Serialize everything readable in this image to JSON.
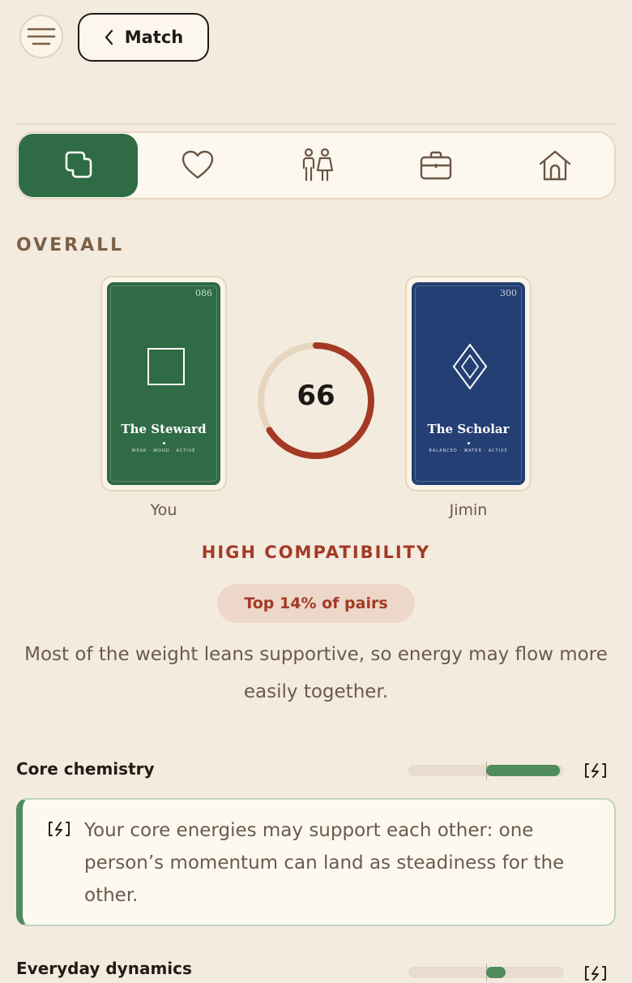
{
  "header": {
    "menu_icon": "hamburger-icon",
    "back_label": "Match",
    "back_icon": "chevron-left-icon"
  },
  "tabs": [
    {
      "icon": "overlap-squares-icon",
      "active": true
    },
    {
      "icon": "heart-icon",
      "active": false
    },
    {
      "icon": "people-icon",
      "active": false
    },
    {
      "icon": "briefcase-icon",
      "active": false
    },
    {
      "icon": "home-icon",
      "active": false
    }
  ],
  "overall": {
    "section_label": "OVERALL",
    "you_card": {
      "number": "086",
      "title": "The Steward",
      "subtitle": "WEAK · WOOD · ACTIVE",
      "color": "#2f6b45",
      "label": "You",
      "symbol": "square-icon"
    },
    "partner_card": {
      "number": "300",
      "title": "The Scholar",
      "subtitle": "BALANCED · WATER · ACTIVE",
      "color": "#233f73",
      "label": "Jimin",
      "symbol": "diamond-icon"
    },
    "score": "66",
    "score_fraction": 0.66,
    "compatibility_label": "HIGH COMPATIBILITY",
    "rank_pill": "Top 14% of pairs",
    "description": "Most of the weight leans supportive, so energy may flow more easily together."
  },
  "metrics": [
    {
      "label": "Core chemistry",
      "from": 0,
      "to": 0.95,
      "icon": "energy-icon",
      "note": "Your core energies may support each other: one person’s momentum can land as steadiness for the other."
    },
    {
      "label": "Everyday dynamics",
      "from": 0,
      "to": 0.25,
      "icon": "energy-icon"
    }
  ],
  "colors": {
    "accent_green": "#2f6b45",
    "accent_red": "#a33a25",
    "ring_track": "#e6d6bd",
    "background": "#f4ebdf"
  }
}
